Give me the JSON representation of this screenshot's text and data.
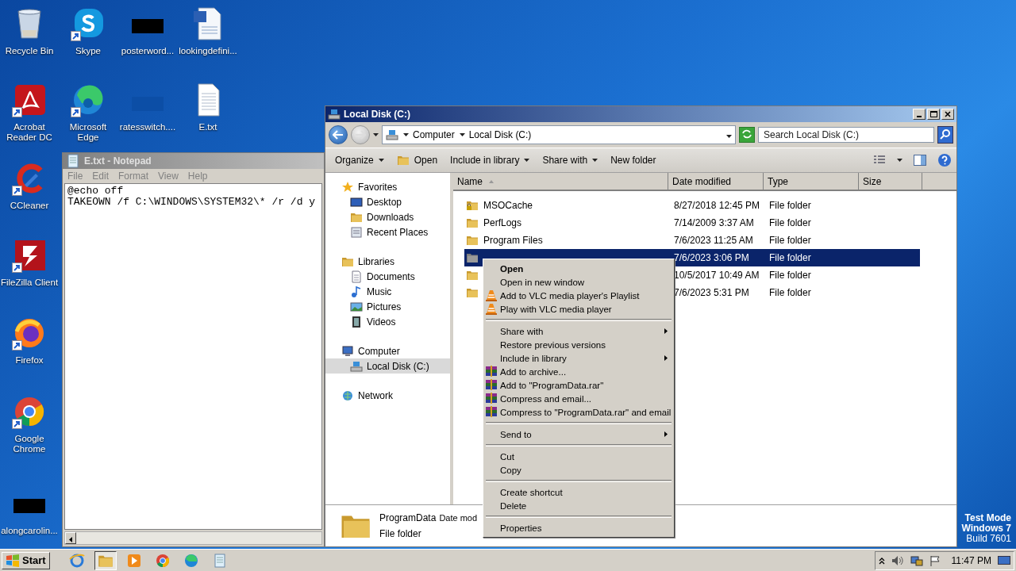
{
  "desktop_icons": [
    {
      "label": "Recycle Bin",
      "kind": "recycle",
      "shortcut": false
    },
    {
      "label": "Skype",
      "kind": "skype",
      "shortcut": true
    },
    {
      "label": "posterword...",
      "kind": "dark-file",
      "shortcut": false
    },
    {
      "label": "lookingdefini...",
      "kind": "word",
      "shortcut": false
    },
    {
      "label": "Acrobat Reader DC",
      "kind": "acrobat",
      "shortcut": true
    },
    {
      "label": "Microsoft Edge",
      "kind": "edge",
      "shortcut": true
    },
    {
      "label": "ratesswitch....",
      "kind": "blue-file",
      "shortcut": false
    },
    {
      "label": "E.txt",
      "kind": "text",
      "shortcut": false
    },
    {
      "label": "CCleaner",
      "kind": "ccleaner",
      "shortcut": true
    },
    {
      "label": "FileZilla Client",
      "kind": "filezilla",
      "shortcut": true
    },
    {
      "label": "Firefox",
      "kind": "firefox",
      "shortcut": true
    },
    {
      "label": "Google Chrome",
      "kind": "chrome",
      "shortcut": true
    },
    {
      "label": "alongcarolin...",
      "kind": "dark-file",
      "shortcut": false
    }
  ],
  "notepad": {
    "title": "E.txt - Notepad",
    "active": false,
    "menu": [
      "File",
      "Edit",
      "Format",
      "View",
      "Help"
    ],
    "lines": [
      "@echo off",
      "TAKEOWN /f C:\\WINDOWS\\SYSTEM32\\* /r /d y"
    ]
  },
  "explorer": {
    "title": "Local Disk (C:)",
    "active": true,
    "breadcrumb": [
      "Computer",
      "Local Disk (C:)"
    ],
    "search": {
      "placeholder": "Search Local Disk (C:)"
    },
    "toolbar": [
      {
        "label": "Organize",
        "dropdown": true,
        "kind": "text"
      },
      {
        "label": "Open",
        "dropdown": false,
        "kind": "folder"
      },
      {
        "label": "Include in library",
        "dropdown": true,
        "kind": "text"
      },
      {
        "label": "Share with",
        "dropdown": true,
        "kind": "text"
      },
      {
        "label": "New folder",
        "dropdown": false,
        "kind": "text"
      }
    ],
    "nav": [
      {
        "label": "Favorites",
        "kind": "star",
        "selected": false,
        "children": [
          {
            "label": "Desktop",
            "kind": "desktop",
            "selected": false
          },
          {
            "label": "Downloads",
            "kind": "downloads",
            "selected": false
          },
          {
            "label": "Recent Places",
            "kind": "recent",
            "selected": false
          }
        ]
      },
      {
        "label": "Libraries",
        "kind": "library",
        "selected": false,
        "children": [
          {
            "label": "Documents",
            "kind": "documents",
            "selected": false
          },
          {
            "label": "Music",
            "kind": "music",
            "selected": false
          },
          {
            "label": "Pictures",
            "kind": "pictures",
            "selected": false
          },
          {
            "label": "Videos",
            "kind": "videos",
            "selected": false
          }
        ]
      },
      {
        "label": "Computer",
        "kind": "computer",
        "selected": false,
        "children": [
          {
            "label": "Local Disk (C:)",
            "kind": "drive",
            "selected": true
          }
        ]
      },
      {
        "label": "Network",
        "kind": "network",
        "selected": false
      }
    ],
    "columns": [
      "Name",
      "Date modified",
      "Type",
      "Size"
    ],
    "rows": [
      {
        "name": "MSOCache",
        "kind": "locked",
        "date": "8/27/2018 12:45 PM",
        "type": "File folder",
        "selected": false
      },
      {
        "name": "PerfLogs",
        "kind": "folder",
        "date": "7/14/2009 3:37 AM",
        "type": "File folder",
        "selected": false
      },
      {
        "name": "Program Files",
        "kind": "folder",
        "date": "7/6/2023 11:25 AM",
        "type": "File folder",
        "selected": false
      },
      {
        "kind": "hidden",
        "date": "7/6/2023 3:06 PM",
        "type": "File folder",
        "selected": true
      },
      {
        "kind": "folder",
        "date": "10/5/2017 10:49 AM",
        "type": "File folder",
        "selected": false
      },
      {
        "kind": "folder",
        "date": "7/6/2023 5:31 PM",
        "type": "File folder",
        "selected": false
      }
    ],
    "details": {
      "name": "ProgramData",
      "field": "Date mod",
      "type": "File folder"
    }
  },
  "context_menu": {
    "groups": [
      [
        {
          "label": "Open",
          "default": true,
          "kind": "plain",
          "submenu": false
        },
        {
          "label": "Open in new window",
          "default": false,
          "kind": "plain",
          "submenu": false
        },
        {
          "label": "Add to VLC media player's Playlist",
          "default": false,
          "kind": "vlc",
          "submenu": false
        },
        {
          "label": "Play with VLC media player",
          "default": false,
          "kind": "vlc",
          "submenu": false
        }
      ],
      [
        {
          "label": "Share with",
          "default": false,
          "kind": "plain",
          "submenu": true
        },
        {
          "label": "Restore previous versions",
          "default": false,
          "kind": "plain",
          "submenu": false
        },
        {
          "label": "Include in library",
          "default": false,
          "kind": "plain",
          "submenu": true
        },
        {
          "label": "Add to archive...",
          "default": false,
          "kind": "rar",
          "submenu": false
        },
        {
          "label": "Add to \"ProgramData.rar\"",
          "default": false,
          "kind": "rar",
          "submenu": false
        },
        {
          "label": "Compress and email...",
          "default": false,
          "kind": "rar",
          "submenu": false
        },
        {
          "label": "Compress to \"ProgramData.rar\" and email",
          "default": false,
          "kind": "rar",
          "submenu": false
        }
      ],
      [
        {
          "label": "Send to",
          "default": false,
          "kind": "plain",
          "submenu": true
        }
      ],
      [
        {
          "label": "Cut",
          "default": false,
          "kind": "plain",
          "submenu": false
        },
        {
          "label": "Copy",
          "default": false,
          "kind": "plain",
          "submenu": false
        }
      ],
      [
        {
          "label": "Create shortcut",
          "default": false,
          "kind": "plain",
          "submenu": false
        },
        {
          "label": "Delete",
          "default": false,
          "kind": "plain",
          "submenu": false
        }
      ],
      [
        {
          "label": "Properties",
          "default": false,
          "kind": "plain",
          "submenu": false
        }
      ]
    ]
  },
  "os_notice": [
    "Test Mode",
    "Windows 7",
    "Build 7601"
  ],
  "taskbar": {
    "start": "Start",
    "apps": [
      {
        "kind": "ie",
        "selected": false
      },
      {
        "kind": "explorer",
        "selected": true
      },
      {
        "kind": "media",
        "selected": false
      },
      {
        "kind": "chrome",
        "selected": false
      },
      {
        "kind": "edge",
        "selected": false
      },
      {
        "kind": "notepad",
        "selected": false
      }
    ],
    "clock": "11:47 PM"
  }
}
